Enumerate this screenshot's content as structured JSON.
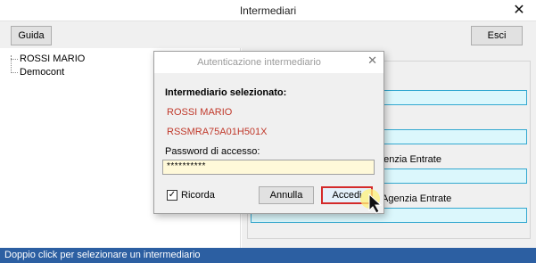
{
  "window": {
    "title": "Intermediari"
  },
  "toolbar": {
    "guida_label": "Guida",
    "esci_label": "Esci"
  },
  "tree": {
    "items": [
      {
        "label": "ROSSI MARIO"
      },
      {
        "label": "Democont"
      }
    ]
  },
  "right_panel": {
    "label_agenzia_1": "genzia Entrate",
    "label_agenzia_2": "Agenzia Entrate",
    "password_value": "**********"
  },
  "dialog": {
    "title": "Autenticazione intermediario",
    "selected_heading": "Intermediario selezionato:",
    "intermediary_name": "ROSSI MARIO",
    "fiscal_code": "RSSMRA75A01H501X",
    "password_label": "Password di accesso:",
    "password_value": "**********",
    "remember_label": "Ricorda",
    "remember_checked": true,
    "cancel_label": "Annulla",
    "login_label": "Accedi"
  },
  "status": {
    "text": "Doppio click per selezionare un intermediario"
  },
  "colors": {
    "status_bar": "#2c5fa2",
    "field_highlight": "#dbf7fc",
    "field_border": "#33a8d0",
    "accent_red": "#c0392b",
    "password_bg": "#fff9d9"
  }
}
